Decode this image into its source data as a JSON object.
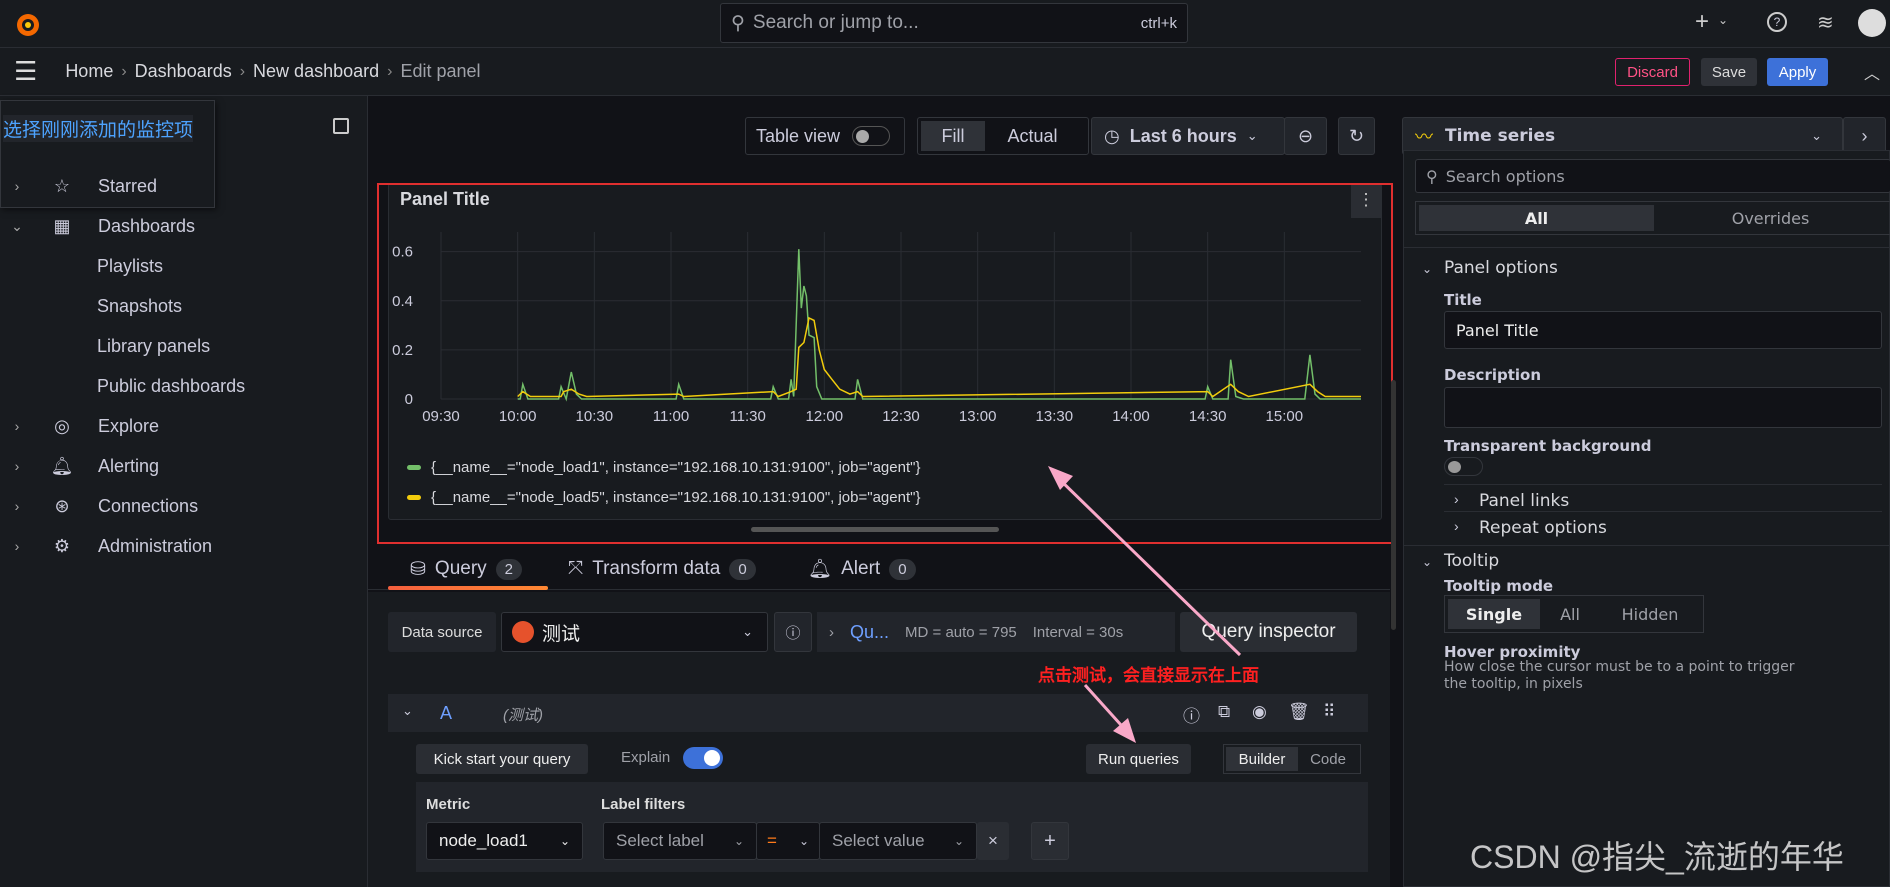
{
  "topbar": {
    "search_placeholder": "Search or jump to...",
    "shortcut": "ctrl+k"
  },
  "breadcrumb": [
    "Home",
    "Dashboards",
    "New dashboard",
    "Edit panel"
  ],
  "actions": {
    "discard": "Discard",
    "save": "Save",
    "apply": "Apply"
  },
  "sidebar": {
    "tooltip": "选择刚刚添加的监控项",
    "items": [
      {
        "label": "Starred",
        "icon": "star-icon"
      },
      {
        "label": "Dashboards",
        "icon": "grid-icon"
      },
      {
        "label": "Playlists"
      },
      {
        "label": "Snapshots"
      },
      {
        "label": "Library panels"
      },
      {
        "label": "Public dashboards"
      },
      {
        "label": "Explore",
        "icon": "compass-icon"
      },
      {
        "label": "Alerting",
        "icon": "bell-icon"
      },
      {
        "label": "Connections",
        "icon": "connections-icon"
      },
      {
        "label": "Administration",
        "icon": "gear-icon"
      }
    ]
  },
  "toolbar": {
    "table_view": "Table view",
    "fill": "Fill",
    "actual": "Actual",
    "time_range": "Last 6 hours",
    "visualization": "Time series"
  },
  "panel": {
    "title": "Panel Title"
  },
  "chart_data": {
    "type": "line",
    "title": "Panel Title",
    "x_ticks": [
      "09:30",
      "10:00",
      "10:30",
      "11:00",
      "11:30",
      "12:00",
      "12:30",
      "13:00",
      "13:30",
      "14:00",
      "14:30",
      "15:00"
    ],
    "xlim": [
      "09:30",
      "15:30"
    ],
    "y_ticks": [
      0,
      0.2,
      0.4,
      0.6
    ],
    "ylim": [
      0,
      0.68
    ],
    "grid": true,
    "legend": "bottom",
    "series": [
      {
        "name": "{__name__=\"node_load1\", instance=\"192.168.10.131:9100\", job=\"agent\"}",
        "color": "#73bf69",
        "points": [
          [
            "10:00",
            0
          ],
          [
            "10:01",
            0
          ],
          [
            "10:02",
            0.06
          ],
          [
            "10:04",
            0
          ],
          [
            "10:16",
            0
          ],
          [
            "10:17",
            0.05
          ],
          [
            "10:19",
            0
          ],
          [
            "10:21",
            0.11
          ],
          [
            "10:23",
            0.02
          ],
          [
            "10:25",
            0
          ],
          [
            "11:02",
            0
          ],
          [
            "11:03",
            0.06
          ],
          [
            "11:05",
            0
          ],
          [
            "11:39",
            0
          ],
          [
            "11:40",
            0.05
          ],
          [
            "11:42",
            0
          ],
          [
            "11:46",
            0
          ],
          [
            "11:47",
            0.08
          ],
          [
            "11:48",
            0.01
          ],
          [
            "11:50",
            0.61
          ],
          [
            "11:51",
            0.37
          ],
          [
            "11:52",
            0.46
          ],
          [
            "11:53",
            0.42
          ],
          [
            "11:54",
            0.26
          ],
          [
            "11:56",
            0.25
          ],
          [
            "11:57",
            0.05
          ],
          [
            "11:59",
            0
          ],
          [
            "12:12",
            0
          ],
          [
            "12:13",
            0.08
          ],
          [
            "12:15",
            0
          ],
          [
            "14:29",
            0
          ],
          [
            "14:30",
            0.05
          ],
          [
            "14:32",
            0
          ],
          [
            "14:38",
            0
          ],
          [
            "14:39",
            0.16
          ],
          [
            "14:41",
            0.01
          ],
          [
            "14:44",
            0
          ],
          [
            "15:08",
            0
          ],
          [
            "15:10",
            0.18
          ],
          [
            "15:12",
            0.02
          ],
          [
            "15:14",
            0
          ],
          [
            "15:30",
            0
          ]
        ]
      },
      {
        "name": "{__name__=\"node_load5\", instance=\"192.168.10.131:9100\", job=\"agent\"}",
        "color": "#f2cc0c",
        "points": [
          [
            "10:00",
            0.01
          ],
          [
            "10:02",
            0.03
          ],
          [
            "10:05",
            0.01
          ],
          [
            "10:17",
            0.01
          ],
          [
            "10:18",
            0.03
          ],
          [
            "10:21",
            0.04
          ],
          [
            "10:24",
            0.02
          ],
          [
            "10:27",
            0.01
          ],
          [
            "11:03",
            0.02
          ],
          [
            "11:05",
            0.01
          ],
          [
            "11:40",
            0.03
          ],
          [
            "11:42",
            0.01
          ],
          [
            "11:47",
            0.03
          ],
          [
            "11:49",
            0.04
          ],
          [
            "11:50",
            0.21
          ],
          [
            "11:52",
            0.23
          ],
          [
            "11:54",
            0.33
          ],
          [
            "11:56",
            0.32
          ],
          [
            "11:58",
            0.2
          ],
          [
            "12:00",
            0.12
          ],
          [
            "12:03",
            0.08
          ],
          [
            "12:06",
            0.04
          ],
          [
            "12:10",
            0.02
          ],
          [
            "12:13",
            0.03
          ],
          [
            "12:15",
            0.01
          ],
          [
            "14:30",
            0.03
          ],
          [
            "14:32",
            0.01
          ],
          [
            "14:39",
            0.06
          ],
          [
            "14:42",
            0.03
          ],
          [
            "14:46",
            0.01
          ],
          [
            "15:10",
            0.06
          ],
          [
            "15:13",
            0.03
          ],
          [
            "15:16",
            0.01
          ],
          [
            "15:30",
            0.01
          ]
        ]
      }
    ]
  },
  "tabs": [
    {
      "label": "Query",
      "count": "2"
    },
    {
      "label": "Transform data",
      "count": "0"
    },
    {
      "label": "Alert",
      "count": "0"
    }
  ],
  "query": {
    "datasource_label": "Data source",
    "datasource": "测试",
    "options_label": "Qu...",
    "md": "MD = auto = 795",
    "interval": "Interval = 30s",
    "inspector": "Query inspector",
    "annotation": "点击测试，会直接显示在上面",
    "row_letter": "A",
    "row_ds": "(测试)",
    "kick_start": "Kick start your query",
    "explain": "Explain",
    "run": "Run queries",
    "builder": "Builder",
    "code": "Code",
    "metric_label": "Metric",
    "metric": "node_load1",
    "label_filters": "Label filters",
    "select_label": "Select label",
    "op": "=",
    "select_value": "Select value"
  },
  "options": {
    "search_placeholder": "Search options",
    "all": "All",
    "overrides": "Overrides",
    "panel_options": "Panel options",
    "title_label": "Title",
    "title_value": "Panel Title",
    "description_label": "Description",
    "transparent": "Transparent background",
    "panel_links": "Panel links",
    "repeat": "Repeat options",
    "tooltip": "Tooltip",
    "tooltip_mode": "Tooltip mode",
    "modes": [
      "Single",
      "All",
      "Hidden"
    ],
    "hover": "Hover proximity",
    "hover_desc": "How close the cursor must be to a point to trigger the tooltip, in pixels"
  },
  "watermark": "CSDN @指尖_流逝的年华"
}
